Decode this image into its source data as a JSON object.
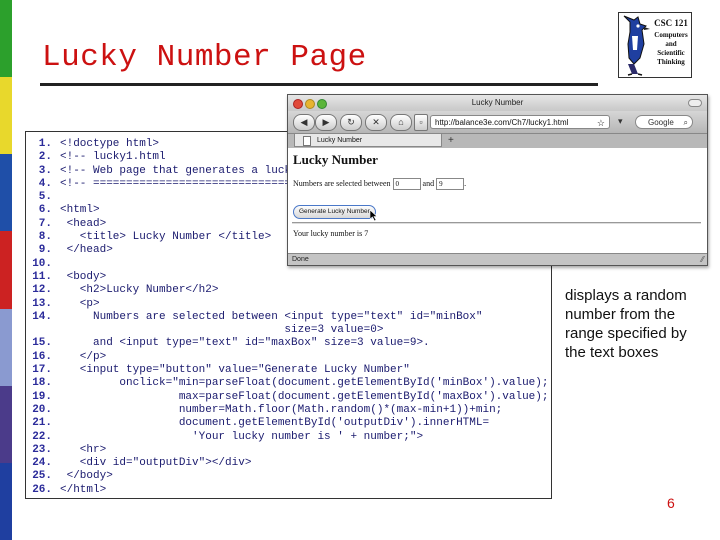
{
  "slide": {
    "title": "Lucky Number Page",
    "description": "displays a random number from the range specified by the text boxes",
    "page_number": "6",
    "stripe_colors": [
      "#2ca02c",
      "#e8d82c",
      "#1f4fa8",
      "#cc2222",
      "#8a9ad0",
      "#4b3b8a",
      "#1f3fa0"
    ]
  },
  "logo": {
    "course": "CSC 121",
    "subtitle": "Computers and Scientific Thinking"
  },
  "code": [
    {
      "ln": "1.",
      "text": "<!doctype html>"
    },
    {
      "ln": "2.",
      "text": "<!-- lucky1.html"
    },
    {
      "ln": "3.",
      "text": "<!-- Web page that generates a luck"
    },
    {
      "ln": "4.",
      "text": "<!-- ================================"
    },
    {
      "ln": "5.",
      "text": ""
    },
    {
      "ln": "6.",
      "text": "<html>"
    },
    {
      "ln": "7.",
      "text": " <head>"
    },
    {
      "ln": "8.",
      "text": "   <title> Lucky Number </title>"
    },
    {
      "ln": "9.",
      "text": " </head>"
    },
    {
      "ln": "10.",
      "text": ""
    },
    {
      "ln": "11.",
      "text": " <body>"
    },
    {
      "ln": "12.",
      "text": "   <h2>Lucky Number</h2>"
    },
    {
      "ln": "13.",
      "text": "   <p>"
    },
    {
      "ln": "14.",
      "text": "     Numbers are selected between <input type=\"text\" id=\"minBox\""
    },
    {
      "ln": "",
      "text": "                                  size=3 value=0>"
    },
    {
      "ln": "15.",
      "text": "     and <input type=\"text\" id=\"maxBox\" size=3 value=9>."
    },
    {
      "ln": "16.",
      "text": "   </p>"
    },
    {
      "ln": "17.",
      "text": "   <input type=\"button\" value=\"Generate Lucky Number\""
    },
    {
      "ln": "18.",
      "text": "         onclick=\"min=parseFloat(document.getElementById('minBox').value);"
    },
    {
      "ln": "19.",
      "text": "                  max=parseFloat(document.getElementById('maxBox').value);"
    },
    {
      "ln": "20.",
      "text": "                  number=Math.floor(Math.random()*(max-min+1))+min;"
    },
    {
      "ln": "21.",
      "text": "                  document.getElementById('outputDiv').innerHTML="
    },
    {
      "ln": "22.",
      "text": "                    'Your lucky number is ' + number;\">"
    },
    {
      "ln": "23.",
      "text": "   <hr>"
    },
    {
      "ln": "24.",
      "text": "   <div id=\"outputDiv\"></div>"
    },
    {
      "ln": "25.",
      "text": " </body>"
    },
    {
      "ln": "26.",
      "text": "</html>"
    }
  ],
  "browser": {
    "window_title": "Lucky Number",
    "url": "http://balance3e.com/Ch7/lucky1.html",
    "search_placeholder": "Google",
    "tab_title": "Lucky Number",
    "heading": "Lucky Number",
    "numbers_label": "Numbers are selected between",
    "min_value": "0",
    "and_label": "and",
    "max_value": "9",
    "period": ".",
    "button_label": "Generate Lucky Number",
    "output": "Your lucky number is 7",
    "status": "Done"
  }
}
